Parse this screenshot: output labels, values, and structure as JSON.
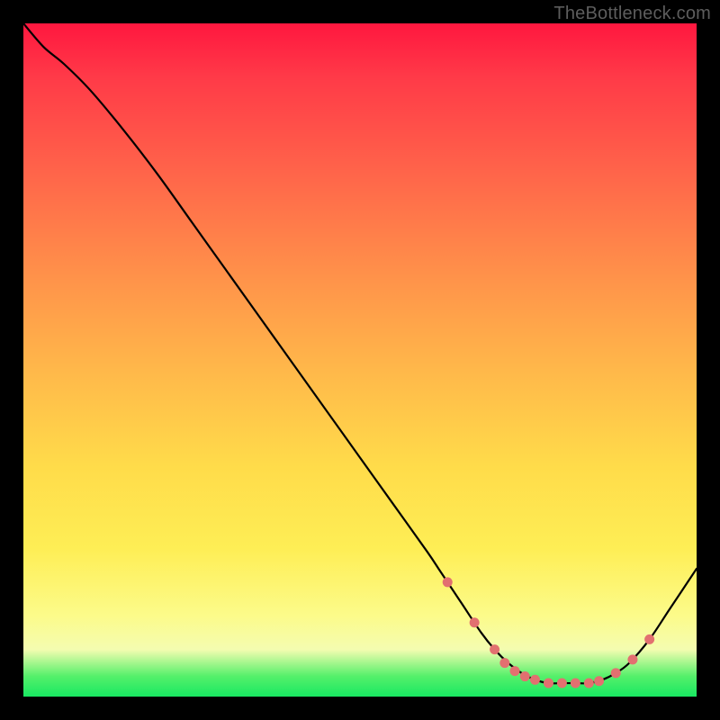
{
  "watermark": "TheBottleneck.com",
  "colors": {
    "frame": "#000000",
    "gradient_top": "#ff173f",
    "gradient_bottom": "#18e862",
    "curve": "#000000",
    "dots": "#e27070"
  },
  "chart_data": {
    "type": "line",
    "title": "",
    "xlabel": "",
    "ylabel": "",
    "xlim": [
      0,
      100
    ],
    "ylim": [
      0,
      100
    ],
    "x": [
      0,
      3,
      6,
      10,
      15,
      20,
      25,
      30,
      35,
      40,
      45,
      50,
      55,
      60,
      62,
      65,
      68,
      70,
      72,
      74,
      76,
      78,
      80,
      82,
      84,
      86,
      88,
      90,
      93,
      96,
      100
    ],
    "y": [
      100,
      96.5,
      94,
      90,
      84,
      77.5,
      70.5,
      63.5,
      56.5,
      49.5,
      42.5,
      35.5,
      28.5,
      21.5,
      18.5,
      14,
      9.5,
      7,
      5,
      3.5,
      2.5,
      2,
      2,
      2,
      2,
      2.5,
      3.5,
      5,
      8.5,
      13,
      19
    ],
    "dots": [
      {
        "x": 63,
        "y": 17
      },
      {
        "x": 67,
        "y": 11
      },
      {
        "x": 70,
        "y": 7
      },
      {
        "x": 71.5,
        "y": 5
      },
      {
        "x": 73,
        "y": 3.8
      },
      {
        "x": 74.5,
        "y": 3
      },
      {
        "x": 76,
        "y": 2.5
      },
      {
        "x": 78,
        "y": 2
      },
      {
        "x": 80,
        "y": 2
      },
      {
        "x": 82,
        "y": 2
      },
      {
        "x": 84,
        "y": 2
      },
      {
        "x": 85.5,
        "y": 2.3
      },
      {
        "x": 88,
        "y": 3.5
      },
      {
        "x": 90.5,
        "y": 5.5
      },
      {
        "x": 93,
        "y": 8.5
      }
    ]
  }
}
